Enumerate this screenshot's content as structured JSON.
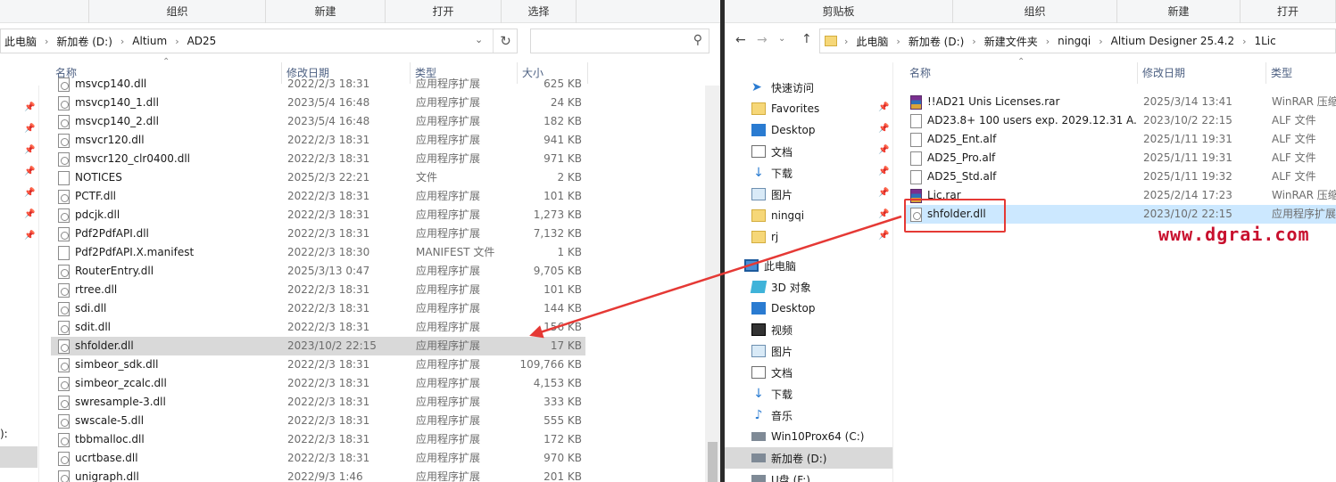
{
  "left": {
    "ribbon": [
      "组织",
      "新建",
      "打开",
      "选择"
    ],
    "breadcrumb": [
      "此电脑",
      "新加卷 (D:)",
      "Altium",
      "AD25"
    ],
    "columns": {
      "name": "名称",
      "date": "修改日期",
      "type": "类型",
      "size": "大小"
    },
    "side_label": "):",
    "files": [
      {
        "name": "msvcp140.dll",
        "date": "2022/2/3 18:31",
        "type": "应用程序扩展",
        "size": "625 KB"
      },
      {
        "name": "msvcp140_1.dll",
        "date": "2023/5/4 16:48",
        "type": "应用程序扩展",
        "size": "24 KB"
      },
      {
        "name": "msvcp140_2.dll",
        "date": "2023/5/4 16:48",
        "type": "应用程序扩展",
        "size": "182 KB"
      },
      {
        "name": "msvcr120.dll",
        "date": "2022/2/3 18:31",
        "type": "应用程序扩展",
        "size": "941 KB"
      },
      {
        "name": "msvcr120_clr0400.dll",
        "date": "2022/2/3 18:31",
        "type": "应用程序扩展",
        "size": "971 KB"
      },
      {
        "name": "NOTICES",
        "date": "2025/2/3 22:21",
        "type": "文件",
        "size": "2 KB"
      },
      {
        "name": "PCTF.dll",
        "date": "2022/2/3 18:31",
        "type": "应用程序扩展",
        "size": "101 KB"
      },
      {
        "name": "pdcjk.dll",
        "date": "2022/2/3 18:31",
        "type": "应用程序扩展",
        "size": "1,273 KB"
      },
      {
        "name": "Pdf2PdfAPI.dll",
        "date": "2022/2/3 18:31",
        "type": "应用程序扩展",
        "size": "7,132 KB"
      },
      {
        "name": "Pdf2PdfAPI.X.manifest",
        "date": "2022/2/3 18:30",
        "type": "MANIFEST 文件",
        "size": "1 KB"
      },
      {
        "name": "RouterEntry.dll",
        "date": "2025/3/13 0:47",
        "type": "应用程序扩展",
        "size": "9,705 KB"
      },
      {
        "name": "rtree.dll",
        "date": "2022/2/3 18:31",
        "type": "应用程序扩展",
        "size": "101 KB"
      },
      {
        "name": "sdi.dll",
        "date": "2022/2/3 18:31",
        "type": "应用程序扩展",
        "size": "144 KB"
      },
      {
        "name": "sdit.dll",
        "date": "2022/2/3 18:31",
        "type": "应用程序扩展",
        "size": "156 KB"
      },
      {
        "name": "shfolder.dll",
        "date": "2023/10/2 22:15",
        "type": "应用程序扩展",
        "size": "17 KB"
      },
      {
        "name": "simbeor_sdk.dll",
        "date": "2022/2/3 18:31",
        "type": "应用程序扩展",
        "size": "109,766 KB"
      },
      {
        "name": "simbeor_zcalc.dll",
        "date": "2022/2/3 18:31",
        "type": "应用程序扩展",
        "size": "4,153 KB"
      },
      {
        "name": "swresample-3.dll",
        "date": "2022/2/3 18:31",
        "type": "应用程序扩展",
        "size": "333 KB"
      },
      {
        "name": "swscale-5.dll",
        "date": "2022/2/3 18:31",
        "type": "应用程序扩展",
        "size": "555 KB"
      },
      {
        "name": "tbbmalloc.dll",
        "date": "2022/2/3 18:31",
        "type": "应用程序扩展",
        "size": "172 KB"
      },
      {
        "name": "ucrtbase.dll",
        "date": "2022/2/3 18:31",
        "type": "应用程序扩展",
        "size": "970 KB"
      },
      {
        "name": "unigraph.dll",
        "date": "2022/9/3 1:46",
        "type": "应用程序扩展",
        "size": "201 KB"
      }
    ]
  },
  "right": {
    "ribbon": [
      "剪贴板",
      "组织",
      "新建",
      "打开"
    ],
    "breadcrumb": [
      "此电脑",
      "新加卷 (D:)",
      "新建文件夹",
      "ningqi",
      "Altium Designer 25.4.2",
      "1Lic"
    ],
    "columns": {
      "name": "名称",
      "date": "修改日期",
      "type": "类型"
    },
    "nav": [
      {
        "label": "快速访问",
        "icon": "star-icon"
      },
      {
        "label": "Favorites",
        "icon": "folder-icon"
      },
      {
        "label": "Desktop",
        "icon": "desktop-icon"
      },
      {
        "label": "文档",
        "icon": "document-icon"
      },
      {
        "label": "下载",
        "icon": "download-icon"
      },
      {
        "label": "图片",
        "icon": "picture-icon"
      },
      {
        "label": "ningqi",
        "icon": "folder-icon"
      },
      {
        "label": "rj",
        "icon": "folder-icon"
      },
      {
        "label": "此电脑",
        "icon": "pc-icon"
      },
      {
        "label": "3D 对象",
        "icon": "cube-icon"
      },
      {
        "label": "Desktop",
        "icon": "desktop-icon"
      },
      {
        "label": "视频",
        "icon": "video-icon"
      },
      {
        "label": "图片",
        "icon": "picture-icon"
      },
      {
        "label": "文档",
        "icon": "document-icon"
      },
      {
        "label": "下载",
        "icon": "download-icon"
      },
      {
        "label": "音乐",
        "icon": "music-icon"
      },
      {
        "label": "Win10Prox64 (C:)",
        "icon": "drive-icon"
      },
      {
        "label": "新加卷 (D:)",
        "icon": "drive-icon"
      },
      {
        "label": "U盘 (F:)",
        "icon": "drive-icon"
      }
    ],
    "files": [
      {
        "name": "!!AD21 Unis Licenses.rar",
        "date": "2025/3/14 13:41",
        "type": "WinRAR 压缩",
        "kind": "rar"
      },
      {
        "name": "AD23.8+ 100 users exp. 2029.12.31 A...",
        "date": "2023/10/2 22:15",
        "type": "ALF 文件",
        "kind": "file"
      },
      {
        "name": "AD25_Ent.alf",
        "date": "2025/1/11 19:31",
        "type": "ALF 文件",
        "kind": "file"
      },
      {
        "name": "AD25_Pro.alf",
        "date": "2025/1/11 19:31",
        "type": "ALF 文件",
        "kind": "file"
      },
      {
        "name": "AD25_Std.alf",
        "date": "2025/1/11 19:32",
        "type": "ALF 文件",
        "kind": "file"
      },
      {
        "name": "Lic.rar",
        "date": "2025/2/14 17:23",
        "type": "WinRAR 压缩",
        "kind": "rar"
      },
      {
        "name": "shfolder.dll",
        "date": "2023/10/2 22:15",
        "type": "应用程序扩展",
        "kind": "dll"
      }
    ]
  },
  "watermark": "www.dgrai.com",
  "colors": {
    "arrow": "#e53935",
    "watermark": "#c8102e",
    "selection": "#cce8ff"
  }
}
